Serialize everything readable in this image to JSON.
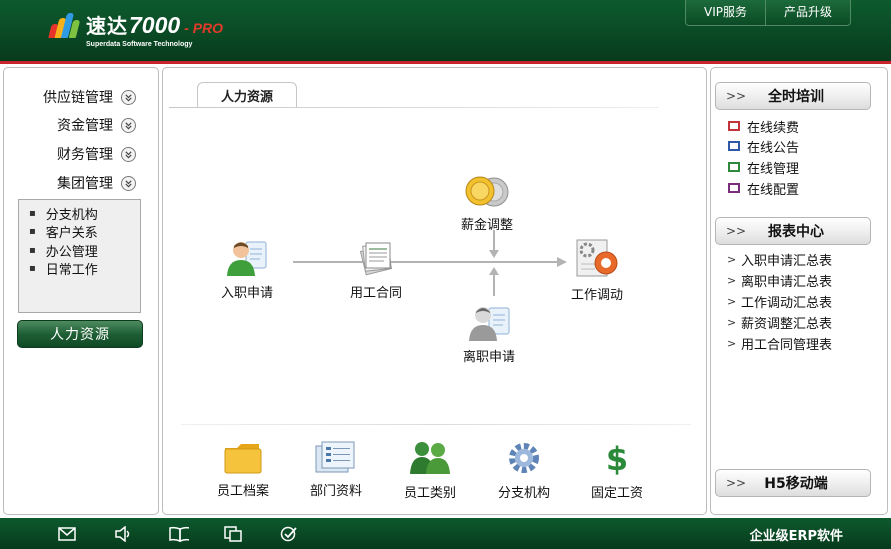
{
  "app": {
    "logo_cn": "速达",
    "logo_num": "7000",
    "logo_pro": "- PRO",
    "logo_sub": "Superdata Software Technology"
  },
  "topnav": {
    "vip_label": "VIP服务",
    "upgrade_label": "产品升级"
  },
  "sidebar": {
    "menus": [
      {
        "label": "供应链管理",
        "icon": "chevron-down-icon"
      },
      {
        "label": "资金管理",
        "icon": "chevron-down-icon"
      },
      {
        "label": "财务管理",
        "icon": "chevron-down-icon"
      },
      {
        "label": "集团管理",
        "icon": "chevron-down-icon"
      }
    ],
    "group_items": [
      "分支机构",
      "客户关系",
      "办公管理",
      "日常工作"
    ],
    "active_button": "人力资源"
  },
  "main": {
    "tab_label": "人力资源",
    "flow": {
      "onboard": {
        "label": "入职申请",
        "icon": "user-form-icon"
      },
      "contract": {
        "label": "用工合同",
        "icon": "documents-icon"
      },
      "salary": {
        "label": "薪金调整",
        "icon": "coins-icon"
      },
      "resign": {
        "label": "离职申请",
        "icon": "user-leave-icon"
      },
      "transfer": {
        "label": "工作调动",
        "icon": "gear-document-icon"
      }
    },
    "bottom_icons": [
      {
        "label": "员工档案",
        "icon": "folder-icon"
      },
      {
        "label": "部门资料",
        "icon": "department-list-icon"
      },
      {
        "label": "员工类别",
        "icon": "people-group-icon"
      },
      {
        "label": "分支机构",
        "icon": "gear-icon"
      },
      {
        "label": "固定工资",
        "icon": "dollar-icon"
      }
    ]
  },
  "right": {
    "training": {
      "title": "全时培训",
      "links": [
        "在线续费",
        "在线公告",
        "在线管理",
        "在线配置"
      ]
    },
    "reports": {
      "title": "报表中心",
      "links": [
        "入职申请汇总表",
        "离职申请汇总表",
        "工作调动汇总表",
        "薪资调整汇总表",
        "用工合同管理表"
      ]
    },
    "mobile": {
      "title": "H5移动端"
    }
  },
  "footer": {
    "icons": [
      "mail-icon",
      "speaker-icon",
      "book-icon",
      "copy-icon",
      "check-icon"
    ],
    "text": "企业级ERP软件"
  },
  "colors": {
    "brand_green": "#0a4a25",
    "accent_red": "#c8242b",
    "arrow_gray": "#b3b3b3"
  }
}
